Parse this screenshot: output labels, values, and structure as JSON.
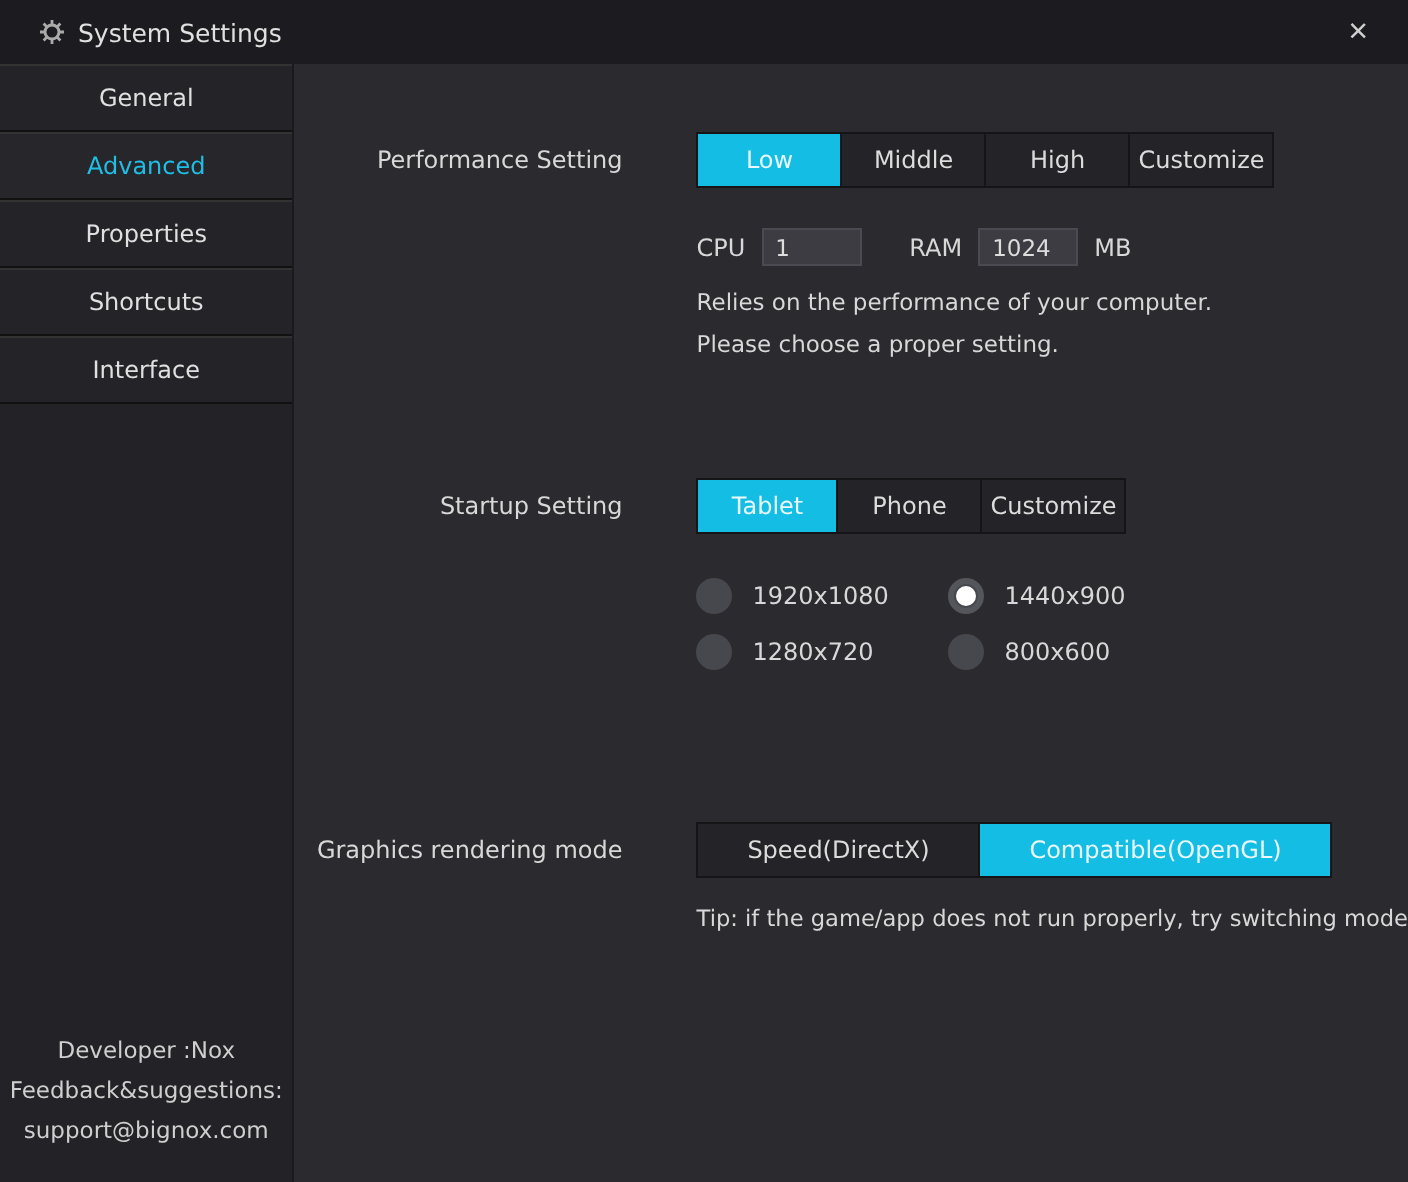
{
  "window": {
    "title": "System Settings",
    "close": "×"
  },
  "sidebar": {
    "items": [
      {
        "label": "General",
        "selected": false
      },
      {
        "label": "Advanced",
        "selected": true
      },
      {
        "label": "Properties",
        "selected": false
      },
      {
        "label": "Shortcuts",
        "selected": false
      },
      {
        "label": "Interface",
        "selected": false
      }
    ],
    "footer": [
      "Developer :Nox",
      "Feedback&suggestions:",
      "support@bignox.com"
    ]
  },
  "performance": {
    "label": "Performance Setting",
    "options": [
      {
        "label": "Low",
        "selected": true
      },
      {
        "label": "Middle",
        "selected": false
      },
      {
        "label": "High",
        "selected": false
      },
      {
        "label": "Customize",
        "selected": false
      }
    ],
    "cpu": {
      "label": "CPU",
      "value": "1"
    },
    "ram": {
      "label": "RAM",
      "value": "1024",
      "unit": "MB"
    },
    "note": [
      "Relies on the performance of your computer.",
      "Please choose a proper setting."
    ]
  },
  "startup": {
    "label": "Startup Setting",
    "options": [
      {
        "label": "Tablet",
        "selected": true
      },
      {
        "label": "Phone",
        "selected": false
      },
      {
        "label": "Customize",
        "selected": false
      }
    ],
    "resolutions": [
      {
        "label": "1920x1080",
        "selected": false
      },
      {
        "label": "1440x900",
        "selected": true
      },
      {
        "label": "1280x720",
        "selected": false
      },
      {
        "label": "800x600",
        "selected": false
      }
    ]
  },
  "graphics": {
    "label": "Graphics rendering mode",
    "options": [
      {
        "label": "Speed(DirectX)",
        "selected": false
      },
      {
        "label": "Compatible(OpenGL)",
        "selected": true
      }
    ],
    "tip": "Tip: if the game/app does not run properly, try switching mode"
  }
}
